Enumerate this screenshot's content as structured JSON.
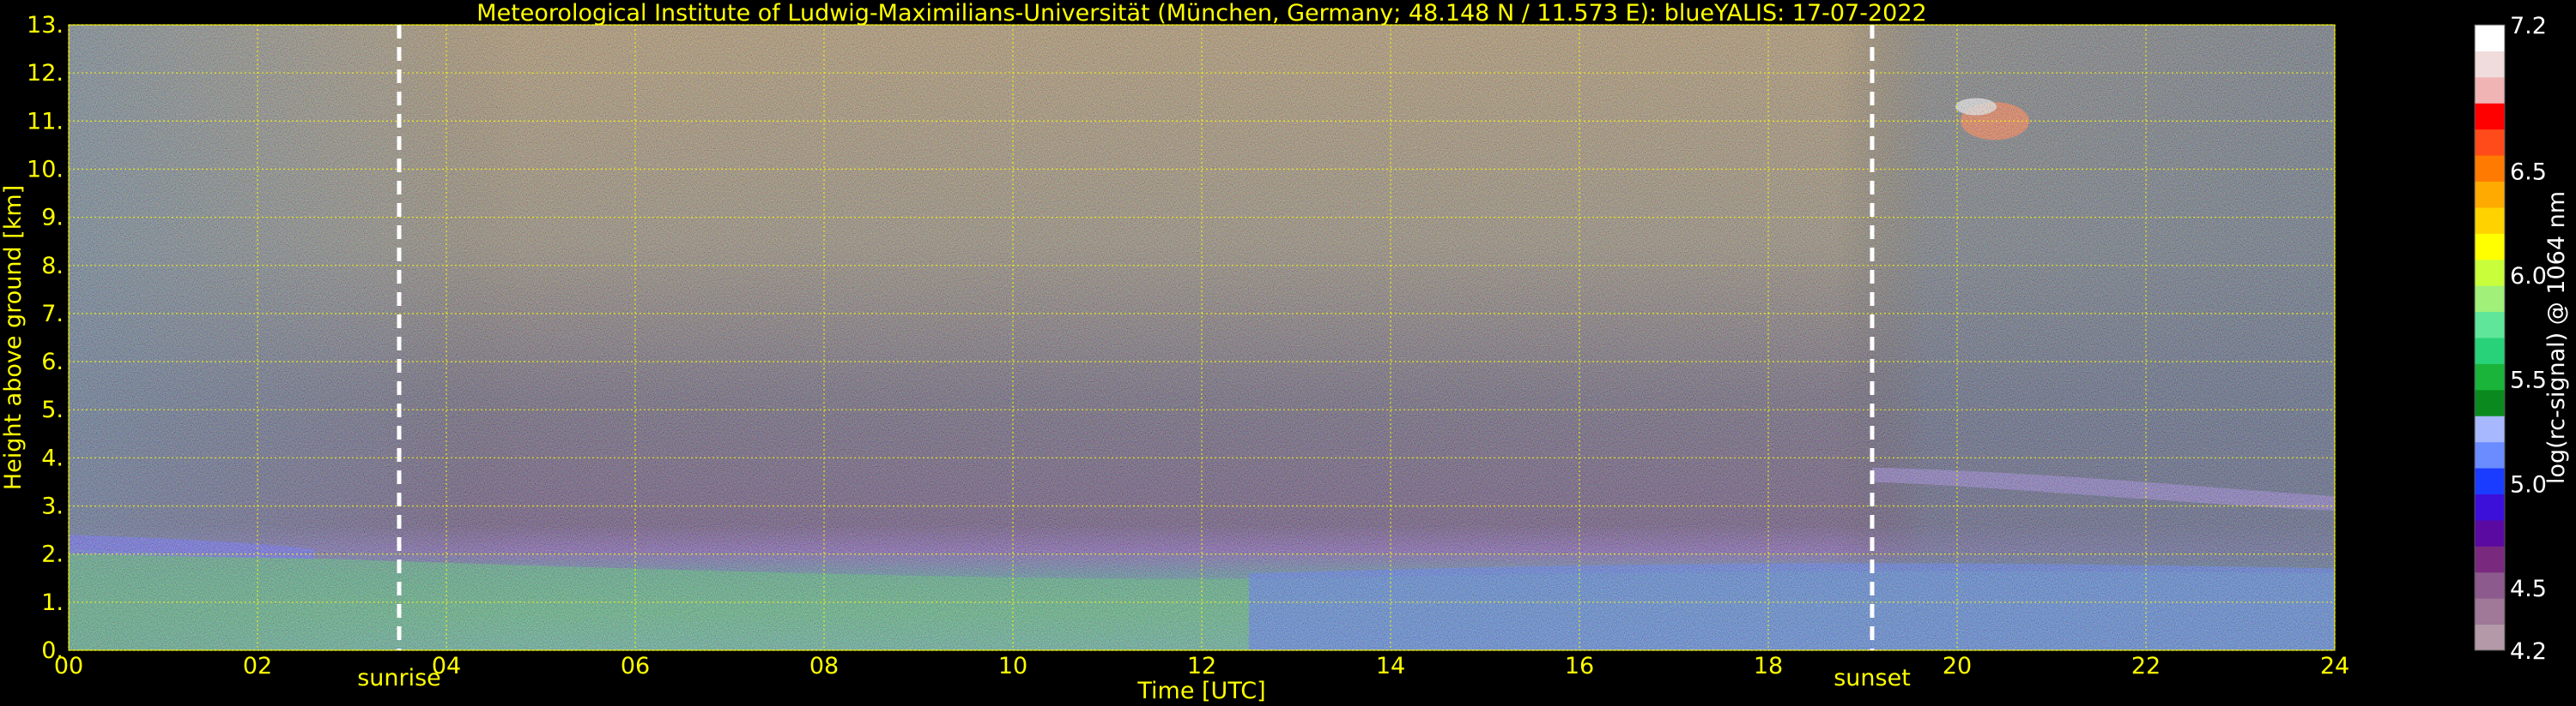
{
  "chart_data": {
    "type": "heatmap",
    "title": "Meteorological Institute of Ludwig-Maximilians-Universität (München, Germany; 48.148 N / 11.573 E):    blueYALIS: 17-07-2022",
    "xlabel": "Time [UTC]",
    "ylabel": "Height above ground [km]",
    "xlim": [
      0,
      24
    ],
    "ylim": [
      0,
      13
    ],
    "x_ticks": [
      "00",
      "02",
      "04",
      "06",
      "08",
      "10",
      "12",
      "14",
      "16",
      "18",
      "20",
      "22",
      "24"
    ],
    "y_ticks": [
      "0.",
      "1.",
      "2.",
      "3.",
      "4.",
      "5.",
      "6.",
      "7.",
      "8.",
      "9.",
      "10.",
      "11.",
      "12.",
      "13."
    ],
    "grid": true,
    "annotations": [
      {
        "label": "sunrise",
        "x": 3.5
      },
      {
        "label": "sunset",
        "x": 19.1
      }
    ],
    "colorbar": {
      "label": "log(rc-signal) @ 1064 nm",
      "range": [
        4.2,
        7.2
      ],
      "ticks": [
        "7.2",
        "6.5",
        "6.0",
        "5.5",
        "5.0",
        "4.5",
        "4.2"
      ],
      "colors": [
        "#b49aa8",
        "#a07898",
        "#8c5a8c",
        "#7a2a7e",
        "#5a0aa0",
        "#3c10d8",
        "#1a3cff",
        "#6a8cff",
        "#a8b8ff",
        "#0a8a1e",
        "#1ab43a",
        "#28d278",
        "#60e69a",
        "#a0f07a",
        "#c8ff3a",
        "#ffff00",
        "#ffd200",
        "#ffaa00",
        "#ff7a00",
        "#ff4a1a",
        "#ff0000",
        "#f0b4b4",
        "#f0dcdc",
        "#ffffff"
      ]
    }
  }
}
